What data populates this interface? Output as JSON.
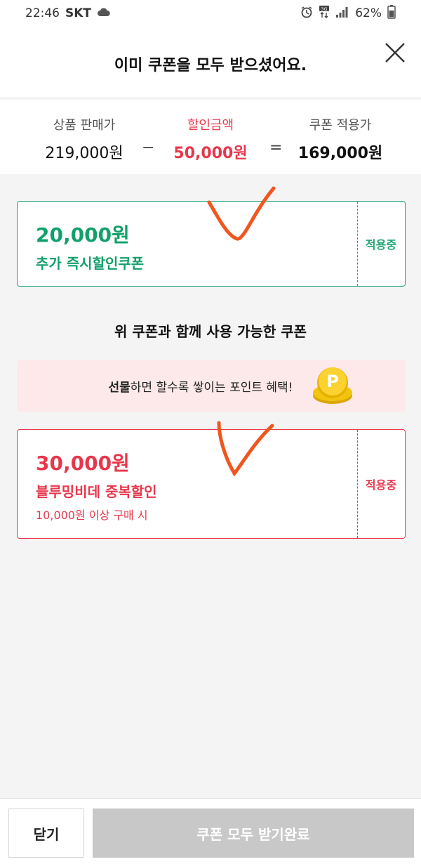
{
  "status_bar": {
    "time": "22:46",
    "carrier": "SKT",
    "battery": "62%"
  },
  "header": {
    "title": "이미 쿠폰을 모두 받으셨어요."
  },
  "summary": {
    "price_label": "상품 판매가",
    "price_value": "219,000원",
    "minus": "−",
    "discount_label": "할인금액",
    "discount_value": "50,000원",
    "equals": "=",
    "final_label": "쿠폰 적용가",
    "final_value": "169,000원"
  },
  "coupon_primary": {
    "amount": "20,000원",
    "name": "추가 즉시할인쿠폰",
    "state": "적용중",
    "color": "#12a06b"
  },
  "section_title": "위 쿠폰과 함께 사용 가능한 쿠폰",
  "banner": {
    "bold": "선물",
    "rest": "하면 할수록 쌓이는 포인트 혜택!"
  },
  "coupon_secondary": {
    "amount": "30,000원",
    "name": "블루밍비데 중복할인",
    "condition": "10,000원 이상 구매 시",
    "state": "적용중",
    "color": "#e8374c"
  },
  "footer": {
    "close_label": "닫기",
    "receive_all_label": "쿠폰 모두 받기완료"
  }
}
